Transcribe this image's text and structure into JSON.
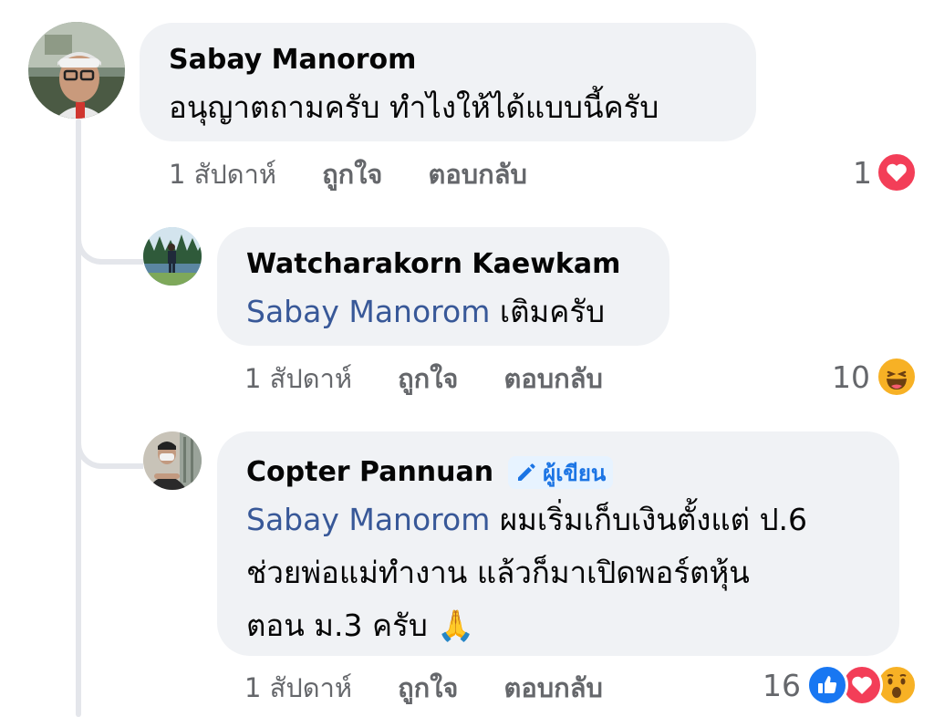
{
  "comment": {
    "author": "Sabay Manorom",
    "text": "อนุญาตถามครับ ทำไงให้ได้แบบนี้ครับ",
    "time": "1 สัปดาห์",
    "like_label": "ถูกใจ",
    "reply_label": "ตอบกลับ",
    "reaction_count": "1",
    "reactions": [
      "love"
    ]
  },
  "replies": [
    {
      "author": "Watcharakorn Kaewkam",
      "mention": "Sabay Manorom",
      "text": "เติมครับ",
      "time": "1 สัปดาห์",
      "like_label": "ถูกใจ",
      "reply_label": "ตอบกลับ",
      "reaction_count": "10",
      "reactions": [
        "haha"
      ]
    },
    {
      "author": "Copter Pannuan",
      "author_badge": "ผู้เขียน",
      "mention": "Sabay Manorom",
      "text_line1": "ผมเริ่มเก็บเงินตั้งแต่ ป.6",
      "text_line2": "ช่วยพ่อแม่ทำงาน แล้วก็มาเปิดพอร์ตหุ้น",
      "text_line3": "ตอน ม.3 ครับ",
      "emoji": "🙏",
      "time": "1 สัปดาห์",
      "like_label": "ถูกใจ",
      "reply_label": "ตอบกลับ",
      "reaction_count": "16",
      "reactions": [
        "like",
        "love",
        "wow"
      ]
    }
  ],
  "colors": {
    "bubble": "#f0f2f5",
    "mention": "#385898",
    "meta": "#65676b",
    "like": "#1877f2",
    "love": "#f33e58",
    "emoji_yellow": "#f7b125",
    "badge_bg": "#e7f3ff",
    "badge_text": "#1b74e4"
  }
}
